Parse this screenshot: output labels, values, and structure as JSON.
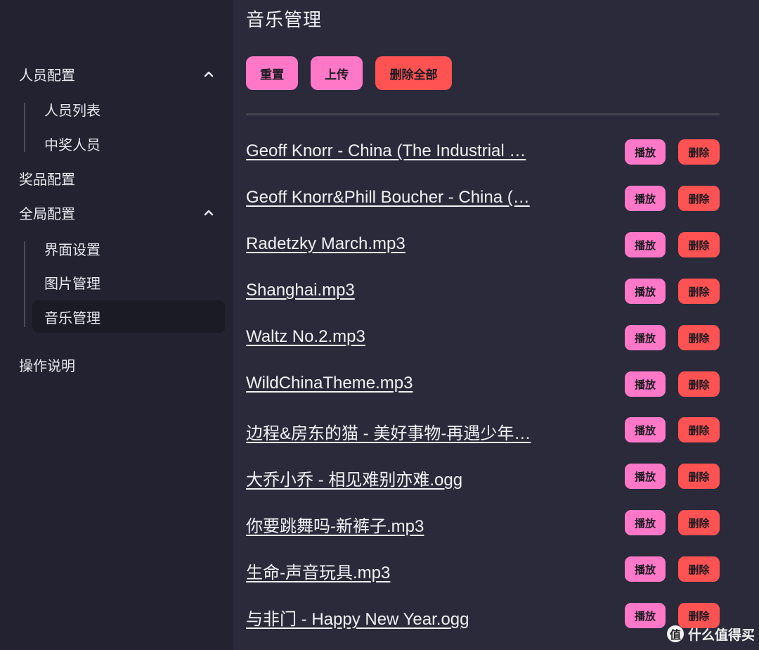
{
  "colors": {
    "sidebar_bg": "#222230",
    "main_bg": "#2a2a3a",
    "pink": "#ff78c8",
    "red": "#ff5252",
    "active_bg": "#1b1b26"
  },
  "sidebar": {
    "personnel": {
      "label": "人员配置",
      "icon": "chevron-up-icon",
      "children": [
        "人员列表",
        "中奖人员"
      ]
    },
    "prize": {
      "label": "奖品配置"
    },
    "global": {
      "label": "全局配置",
      "icon": "chevron-up-icon",
      "children": [
        "界面设置",
        "图片管理",
        "音乐管理"
      ],
      "active": "音乐管理"
    },
    "help": {
      "label": "操作说明"
    }
  },
  "main": {
    "title": "音乐管理",
    "toolbar": {
      "reset_label": "重置",
      "upload_label": "上传",
      "delete_all_label": "删除全部"
    },
    "play_label": "播放",
    "delete_label": "删除",
    "tracks": [
      "Geoff Knorr - China (The Industrial …",
      "Geoff Knorr&Phill Boucher - China (…",
      "Radetzky March.mp3",
      "Shanghai.mp3",
      "Waltz No.2.mp3",
      "WildChinaTheme.mp3",
      "边程&房东的猫 - 美好事物-再遇少年…",
      "大乔小乔 - 相见难别亦难.ogg",
      "你要跳舞吗-新裤子.mp3",
      "生命-声音玩具.mp3",
      "与非门 - Happy New Year.ogg"
    ]
  },
  "watermark": {
    "logo_text": "值",
    "text": "什么值得买"
  }
}
